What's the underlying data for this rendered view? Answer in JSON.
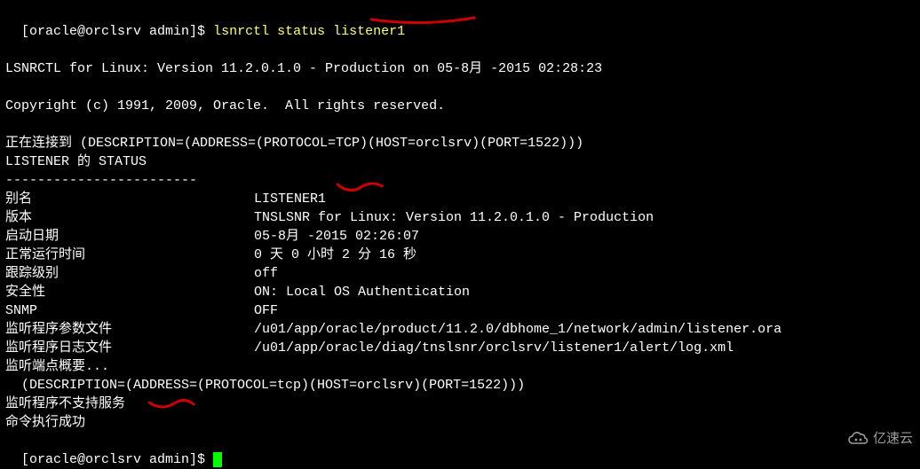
{
  "prompt1": {
    "prefix": "[oracle@orclsrv admin]$ ",
    "command": "lsnrctl status listener1"
  },
  "header_version": "LSNRCTL for Linux: Version 11.2.0.1.0 - Production on 05-8月 -2015 02:28:23",
  "copyright": "Copyright (c) 1991, 2009, Oracle.  All rights reserved.",
  "connecting": "正在连接到 (DESCRIPTION=(ADDRESS=(PROTOCOL=TCP)(HOST=orclsrv)(PORT=1522)))",
  "listener_status_hdr": "LISTENER 的 STATUS",
  "separator": "------------------------",
  "fields": {
    "alias_label": "别名",
    "alias_value": "LISTENER1",
    "version_label": "版本",
    "version_value": "TNSLSNR for Linux: Version 11.2.0.1.0 - Production",
    "startdate_label": "启动日期",
    "startdate_value": "05-8月 -2015 02:26:07",
    "uptime_label": "正常运行时间",
    "uptime_value": "0 天 0 小时 2 分 16 秒",
    "trace_label": "跟踪级别",
    "trace_value": "off",
    "security_label": "安全性",
    "security_value": "ON: Local OS Authentication",
    "snmp_label": "SNMP",
    "snmp_value": "OFF",
    "paramfile_label": "监听程序参数文件",
    "paramfile_value": "/u01/app/oracle/product/11.2.0/dbhome_1/network/admin/listener.ora",
    "logfile_label": "监听程序日志文件",
    "logfile_value": "/u01/app/oracle/diag/tnslsnr/orclsrv/listener1/alert/log.xml"
  },
  "endpoints_hdr": "监听端点概要...",
  "endpoint_line": "  (DESCRIPTION=(ADDRESS=(PROTOCOL=tcp)(HOST=orclsrv)(PORT=1522)))",
  "no_services": "监听程序不支持服务",
  "success": "命令执行成功",
  "prompt2": "[oracle@orclsrv admin]$ ",
  "watermark_text": "亿速云"
}
